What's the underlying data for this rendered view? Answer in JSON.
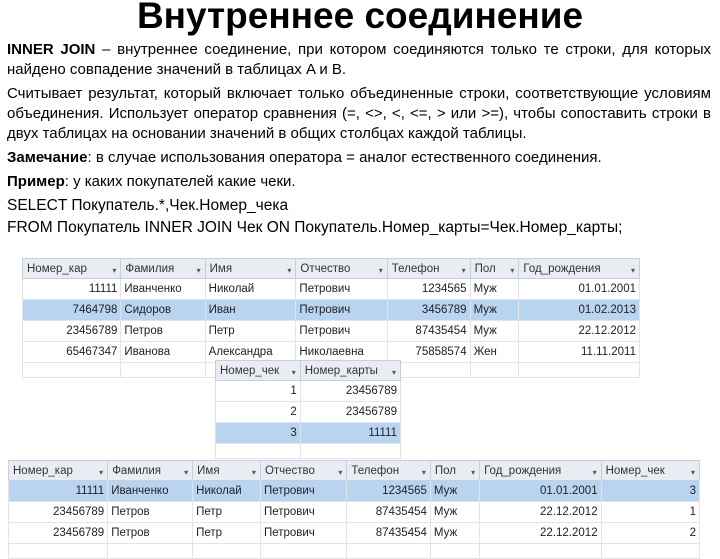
{
  "title": "Внутреннее соединение",
  "paragraphs": {
    "p1_term": "INNER JOIN",
    "p1": " – внутреннее соединение, при котором соединяются только те строки, для которых найдено совпадение значений в таблицах A и B.",
    "p2": "Считывает результат, который включает только объединенные строки, соответствующие условиям объединения. Использует оператор сравнения (=, <>, <, <=, > или >=), чтобы сопоставить строки в двух таблицах на основании значений в общих столбцах каждой таблицы.",
    "p3_term": "Замечание",
    "p3": ": в случае использования оператора = аналог естественного соединения.",
    "p4_term": "Пример",
    "p4": ": у каких покупателей какие чеки.",
    "code1": "SELECT Покупатель.*,Чек.Номер_чека",
    "code2": "FROM Покупатель INNER JOIN Чек ON Покупатель.Номер_карты=Чек.Номер_карты;"
  },
  "tables": [
    {
      "id": "t1",
      "name": "customers-table",
      "headers": [
        "Номер_кар",
        "Фамилия",
        "Имя",
        "Отчество",
        "Телефон",
        "Пол",
        "Год_рождения"
      ],
      "align": [
        "r",
        "l",
        "l",
        "l",
        "r",
        "l",
        "r"
      ],
      "selected_row": 1,
      "rows": [
        [
          "11111",
          "Иванченко",
          "Николай",
          "Петрович",
          "1234565",
          "Муж",
          "01.01.2001"
        ],
        [
          "7464798",
          "Сидоров",
          "Иван",
          "Петрович",
          "3456789",
          "Муж",
          "01.02.2013"
        ],
        [
          "23456789",
          "Петров",
          "Петр",
          "Петрович",
          "87435454",
          "Муж",
          "22.12.2012"
        ],
        [
          "65467347",
          "Иванова",
          "Александра",
          "Николаевна",
          "75858574",
          "Жен",
          "11.11.2011"
        ]
      ]
    },
    {
      "id": "t2",
      "name": "checks-table",
      "headers": [
        "Номер_чек",
        "Номер_карты"
      ],
      "align": [
        "r",
        "r"
      ],
      "selected_row": 2,
      "rows": [
        [
          "1",
          "23456789"
        ],
        [
          "2",
          "23456789"
        ],
        [
          "3",
          "11111"
        ]
      ]
    },
    {
      "id": "t3",
      "name": "result-table",
      "headers": [
        "Номер_кар",
        "Фамилия",
        "Имя",
        "Отчество",
        "Телефон",
        "Пол",
        "Год_рождения",
        "Номер_чек"
      ],
      "align": [
        "r",
        "l",
        "l",
        "l",
        "r",
        "l",
        "r",
        "r"
      ],
      "selected_row": 0,
      "rows": [
        [
          "11111",
          "Иванченко",
          "Николай",
          "Петрович",
          "1234565",
          "Муж",
          "01.01.2001",
          "3"
        ],
        [
          "23456789",
          "Петров",
          "Петр",
          "Петрович",
          "87435454",
          "Муж",
          "22.12.2012",
          "1"
        ],
        [
          "23456789",
          "Петров",
          "Петр",
          "Петрович",
          "87435454",
          "Муж",
          "22.12.2012",
          "2"
        ]
      ]
    }
  ],
  "colors": {
    "selected_row": "#b9d4f1",
    "header_bg": "#e9edf3"
  }
}
